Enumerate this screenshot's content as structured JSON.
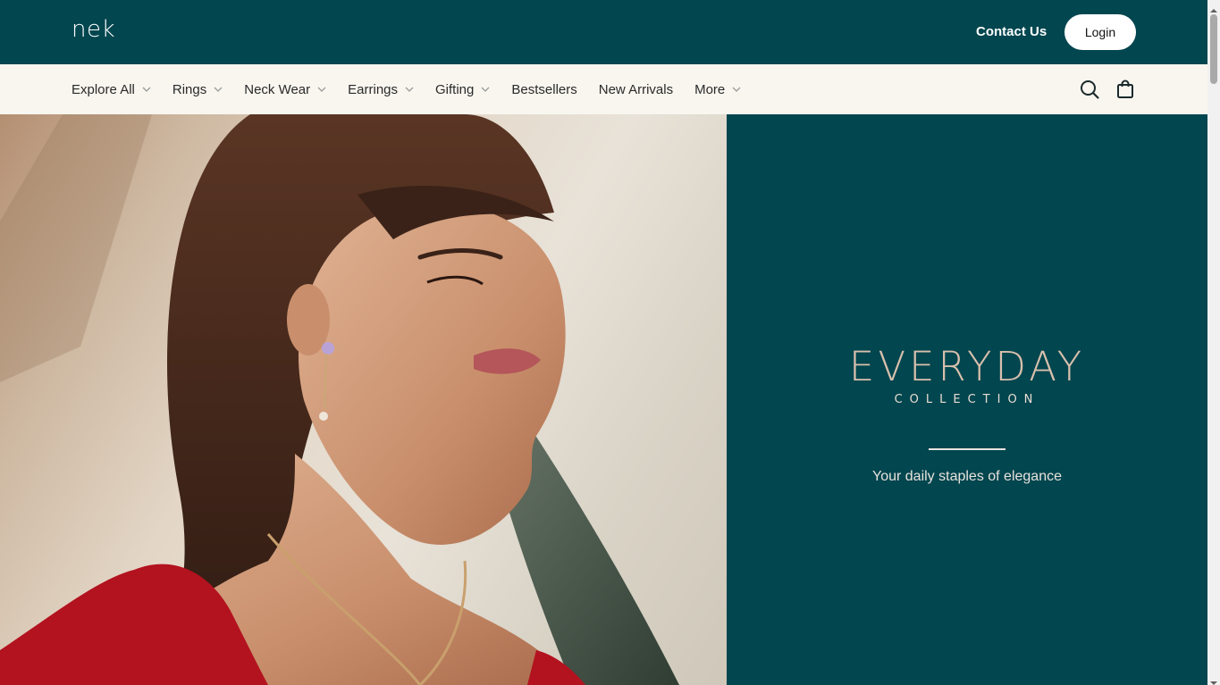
{
  "header": {
    "logo": "nek",
    "contact_label": "Contact Us",
    "login_label": "Login"
  },
  "nav": {
    "items": [
      {
        "label": "Explore All",
        "has_dropdown": true
      },
      {
        "label": "Rings",
        "has_dropdown": true
      },
      {
        "label": "Neck Wear",
        "has_dropdown": true
      },
      {
        "label": "Earrings",
        "has_dropdown": true
      },
      {
        "label": "Gifting",
        "has_dropdown": true
      },
      {
        "label": "Bestsellers",
        "has_dropdown": false
      },
      {
        "label": "New Arrivals",
        "has_dropdown": false
      },
      {
        "label": "More",
        "has_dropdown": true
      }
    ],
    "icons": [
      "search-icon",
      "shopping-bag-icon"
    ]
  },
  "hero": {
    "title": "EVERYDAY",
    "subtitle": "COLLECTION",
    "tagline": "Your daily staples of elegance"
  },
  "colors": {
    "brand_teal": "#02464f",
    "nav_bg": "#f8f6ef",
    "title_rose_gold": "#d9c0ad",
    "dress_red": "#b3121f"
  }
}
